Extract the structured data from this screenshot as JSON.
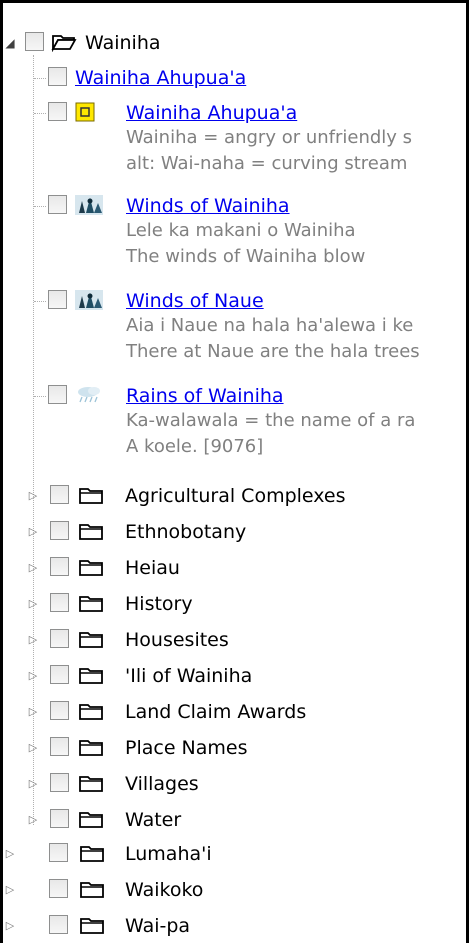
{
  "tree": {
    "root": {
      "label": "Wainiha",
      "expanded": true
    },
    "placemarks": [
      {
        "title": "Wainiha Ahupua'a"
      },
      {
        "title": "Wainiha Ahupua'a",
        "lines": [
          "Wainiha = angry or unfriendly s",
          "alt: Wai-naha = curving stream"
        ],
        "icon": "square-placemark-icon"
      },
      {
        "title": "Winds of Wainiha",
        "lines": [
          "Lele ka makani o Wainiha",
          "The winds of Wainiha blow"
        ],
        "icon": "wind-icon"
      },
      {
        "title": "Winds of Naue",
        "lines": [
          "Aia i Naue na hala ha'alewa i ke",
          "There at Naue are the hala trees"
        ],
        "icon": "wind-icon"
      },
      {
        "title": "Rains of Wainiha",
        "lines": [
          "Ka-walawala = the name of a ra",
          "A koele. [9076]"
        ],
        "icon": "rain-icon"
      }
    ],
    "subfolders": [
      "Agricultural Complexes",
      "Ethnobotany",
      "Heiau",
      "History",
      "Housesites",
      "'Ili of Wainiha",
      "Land Claim Awards",
      "Place Names",
      "Villages",
      "Water"
    ],
    "siblings": [
      "Lumaha'i",
      "Waikoko",
      "Wai-pa"
    ]
  },
  "colors": {
    "link": "#0000ee",
    "description": "#808080",
    "folder": "#000000"
  }
}
